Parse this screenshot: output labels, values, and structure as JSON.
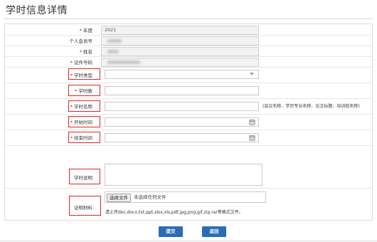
{
  "page": {
    "title": "学时信息详情"
  },
  "form": {
    "year": {
      "label": "年度",
      "required": true,
      "value": "2021"
    },
    "member_no": {
      "label": "个人会员号",
      "required": false
    },
    "name": {
      "label": "姓名",
      "required": true
    },
    "id_no": {
      "label": "证件号码",
      "required": true
    },
    "hour_type": {
      "label": "学时类型",
      "required": true,
      "value": ""
    },
    "hours": {
      "label": "学时数",
      "required": true,
      "value": ""
    },
    "hour_name": {
      "label": "学时名称",
      "required": true,
      "value": "",
      "hint": "(会议名称、学历专业名称、论文标题、培训班名称)"
    },
    "start_time": {
      "label": "开始时间",
      "required": true,
      "value": ""
    },
    "end_time": {
      "label": "结束时间",
      "required": true,
      "value": ""
    },
    "description": {
      "label": "学时说明",
      "required": false,
      "value": ""
    },
    "proof": {
      "label": "证明材料",
      "required": false,
      "choose_label": "选择文件",
      "no_file_text": "未选择任何文件",
      "hint": "请上传doc,docx,txt,ppt,xlsx,xls,pdf,jpg,png,gif,zip,rar等格式文件。"
    }
  },
  "actions": {
    "submit_label": "提交",
    "back_label": "返回"
  },
  "colors": {
    "required_mark": "#d9001b",
    "highlight": "#e02424",
    "button": "#2a6db5"
  },
  "icons": {
    "calendar": "calendar-icon",
    "dropdown": "chevron-down-icon"
  }
}
